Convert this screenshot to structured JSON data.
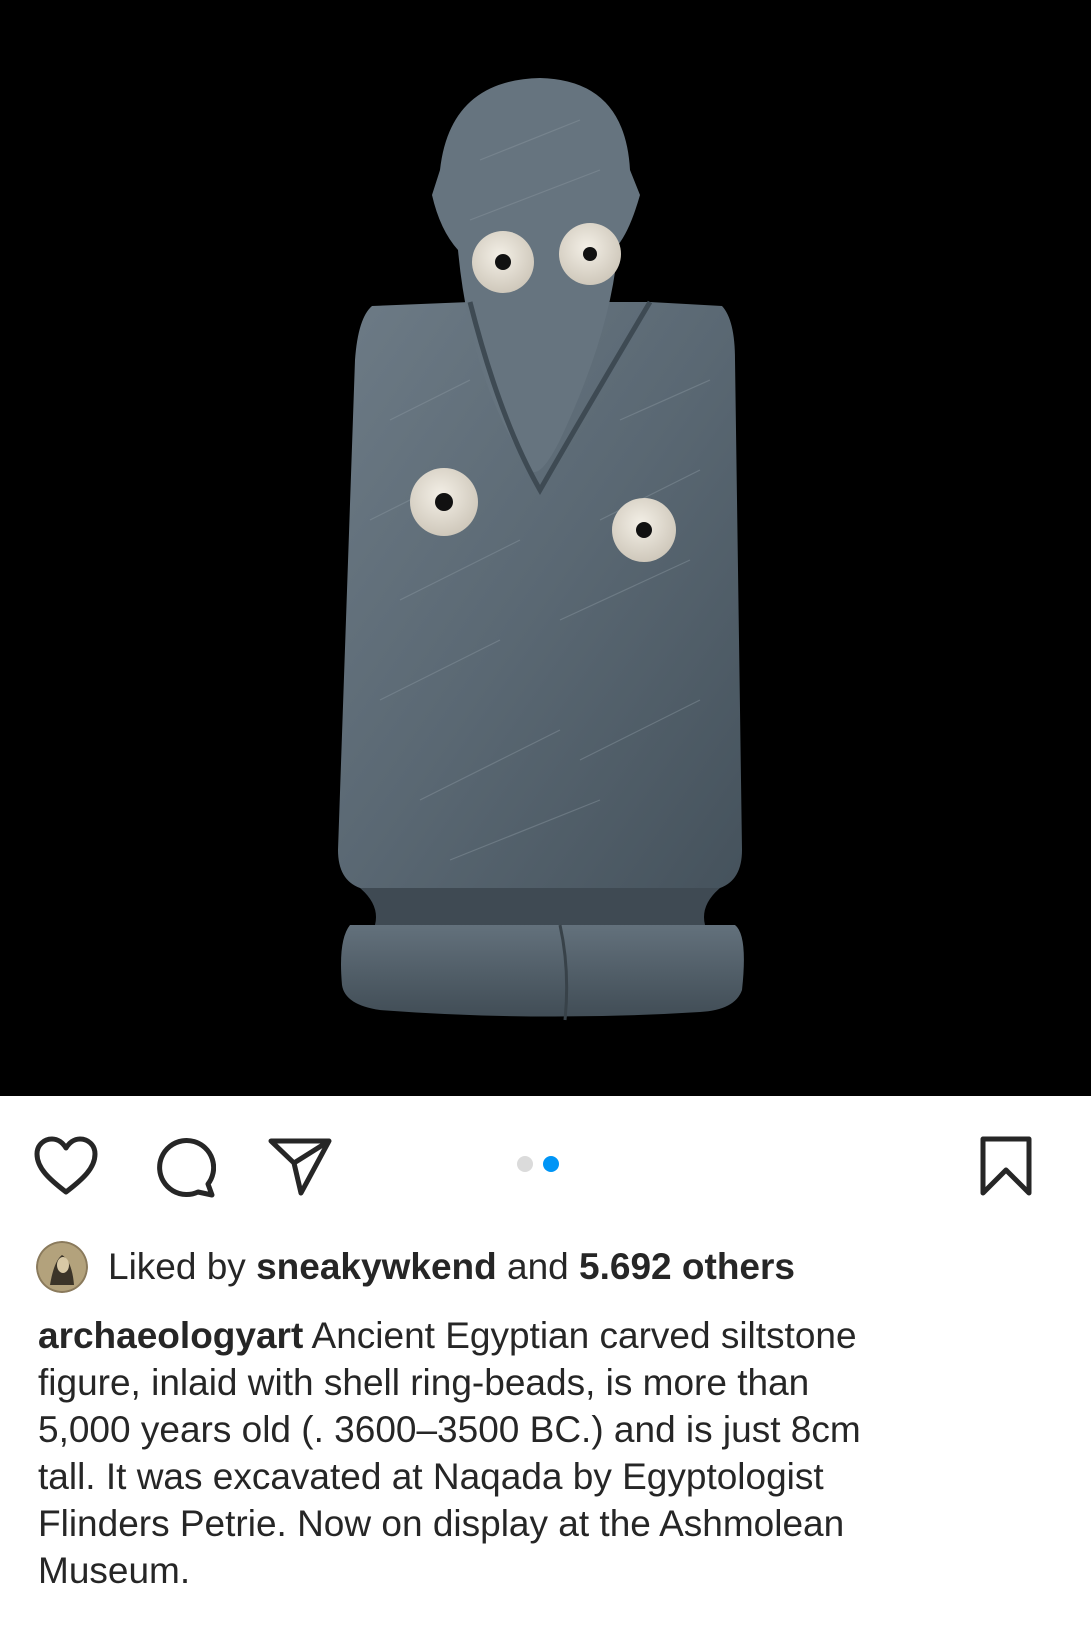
{
  "post": {
    "image_subject": "carved-siltstone-figure",
    "carousel": {
      "count": 2,
      "active_index": 1
    },
    "likes": {
      "prefix": "Liked by",
      "user": "sneakywkend",
      "connector": "and",
      "others": "5.692 others"
    },
    "caption": {
      "username": "archaeologyart",
      "text": "Ancient Egyptian carved siltstone\nfigure, inlaid with shell ring-beads, is more than\n5,000 years old (. 3600–3500 BC.) and is just 8cm\ntall. It was excavated at Naqada by Egyptologist\nFlinders Petrie. Now on display at the  Ashmolean\nMuseum."
    }
  },
  "actions": {
    "like_icon": "heart-outline-icon",
    "comment_icon": "speech-bubble-icon",
    "share_icon": "paper-plane-icon",
    "save_icon": "bookmark-outline-icon"
  },
  "colors": {
    "image_background": "#000000",
    "text": "#262626",
    "active_dot": "#0095f6",
    "inactive_dot": "#dbdbdb",
    "stone": "#5e6c77"
  }
}
